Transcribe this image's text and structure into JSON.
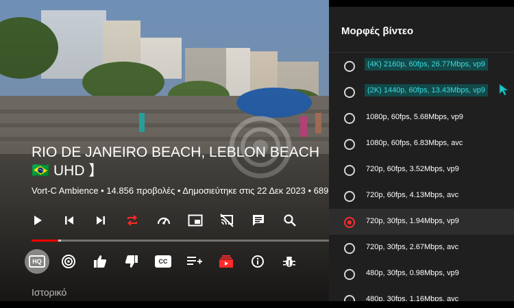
{
  "video": {
    "title": "RIO DE JANEIRO BEACH, LEBLON BEACH 🇧🇷 UHD 】",
    "subtitle": "Vort-C Ambience • 14.856 προβολές • Δημοσιεύτηκε στις 22 Δεκ 2023 • 689",
    "progress_played": 0.09,
    "progress_buffered_start": 0.09,
    "progress_buffered_end": 0.1
  },
  "controls": [
    {
      "icon": "play-icon"
    },
    {
      "icon": "skip-previous-icon"
    },
    {
      "icon": "skip-next-icon"
    },
    {
      "icon": "repeat-icon"
    },
    {
      "icon": "speed-icon"
    },
    {
      "icon": "picture-in-picture-icon"
    },
    {
      "icon": "cast-off-icon"
    },
    {
      "icon": "chat-icon"
    },
    {
      "icon": "search-icon"
    }
  ],
  "actions": [
    {
      "icon": "hq-icon",
      "badge": "HQ"
    },
    {
      "icon": "ambient-icon"
    },
    {
      "icon": "thumb-up-icon"
    },
    {
      "icon": "thumb-down-icon"
    },
    {
      "icon": "subtitles-icon",
      "badge": "CC"
    },
    {
      "icon": "playlist-add-icon"
    },
    {
      "icon": "subscribe-icon"
    },
    {
      "icon": "info-icon"
    },
    {
      "icon": "bug-icon"
    }
  ],
  "history_label": "Ιστορικό",
  "panel": {
    "title": "Μορφές βίντεο",
    "options": [
      {
        "label": "(4K) 2160p, 60fps, 26.77Mbps, vp9",
        "highlighted": true,
        "selected": false
      },
      {
        "label": "(2K) 1440p, 60fps, 13.43Mbps, vp9",
        "highlighted": true,
        "selected": false
      },
      {
        "label": "1080p, 60fps, 5.68Mbps, vp9",
        "highlighted": false,
        "selected": false
      },
      {
        "label": "1080p, 60fps, 6.83Mbps, avc",
        "highlighted": false,
        "selected": false
      },
      {
        "label": "720p, 60fps, 3.52Mbps, vp9",
        "highlighted": false,
        "selected": false
      },
      {
        "label": "720p, 60fps, 4.13Mbps, avc",
        "highlighted": false,
        "selected": false
      },
      {
        "label": "720p, 30fps, 1.94Mbps, vp9",
        "highlighted": false,
        "selected": true
      },
      {
        "label": "720p, 30fps, 2.67Mbps, avc",
        "highlighted": false,
        "selected": false
      },
      {
        "label": "480p, 30fps, 0.98Mbps, vp9",
        "highlighted": false,
        "selected": false
      },
      {
        "label": "480p, 30fps, 1.16Mbps, avc",
        "highlighted": false,
        "selected": false
      }
    ]
  },
  "colors": {
    "accent": "#ff0000",
    "highlight_text": "#3fdbe0",
    "highlight_bg": "#124a4a",
    "panel_bg": "#1f1f1f"
  }
}
